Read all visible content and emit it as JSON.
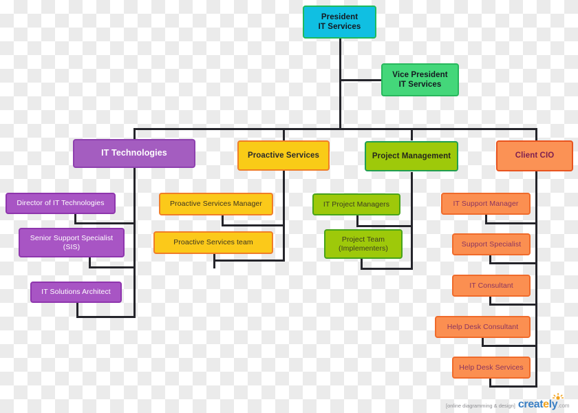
{
  "diagram": {
    "title": "IT Services Organizational Chart",
    "type": "org-chart",
    "colors": {
      "president_fill": "#10bfe2",
      "vice_president_fill": "#44d77a",
      "it_technologies_fill": "#a45dc0",
      "proactive_services_fill": "#f9cb17",
      "project_management_fill": "#9ec90a",
      "client_cio_fill": "#fb9255",
      "connector": "#24242a"
    }
  },
  "nodes": {
    "president": {
      "line1": "President",
      "line2": "IT Services"
    },
    "vice_president": {
      "line1": "Vice President",
      "line2": "IT Services"
    },
    "branches": [
      {
        "head": "IT Technologies",
        "children": [
          {
            "line1": "Director of IT Technologies",
            "line2": ""
          },
          {
            "line1": "Senior Support Specialist",
            "line2": "(SIS)"
          },
          {
            "line1": "IT Solutions Architect",
            "line2": ""
          }
        ]
      },
      {
        "head": "Proactive Services",
        "children": [
          {
            "line1": "Proactive Services Manager",
            "line2": ""
          },
          {
            "line1": "Proactive Services team",
            "line2": ""
          }
        ]
      },
      {
        "head": "Project Management",
        "children": [
          {
            "line1": "IT Project Managers",
            "line2": ""
          },
          {
            "line1": "Project Team",
            "line2": "(Implementers)"
          }
        ]
      },
      {
        "head": "Client CIO",
        "children": [
          {
            "line1": "IT Support Manager",
            "line2": ""
          },
          {
            "line1": "Support Specialist",
            "line2": ""
          },
          {
            "line1": "IT Consultant",
            "line2": ""
          },
          {
            "line1": "Help Desk Consultant",
            "line2": ""
          },
          {
            "line1": "Help Desk Services",
            "line2": ""
          }
        ]
      }
    ]
  },
  "watermark": {
    "tagline": "[online diagramming & design]",
    "brand_part1": "creat",
    "brand_accent": "e",
    "brand_part2": "ly",
    "brand_suffix": ".com",
    "sun_icon": "sun-icon"
  }
}
